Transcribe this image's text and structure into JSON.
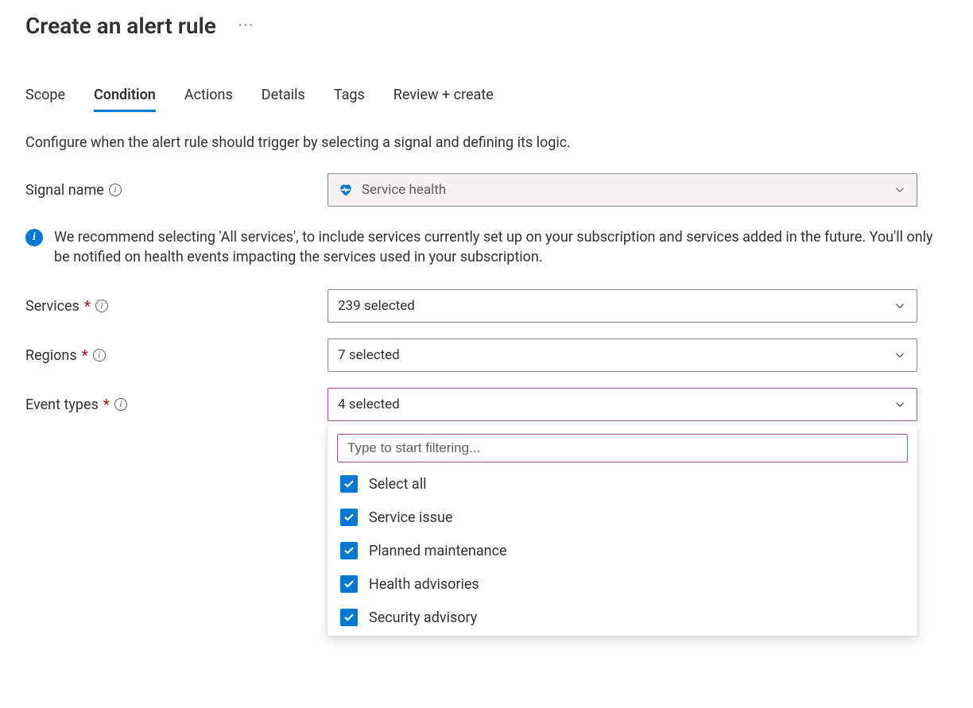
{
  "page": {
    "title": "Create an alert rule"
  },
  "tabs": [
    {
      "label": "Scope",
      "active": false
    },
    {
      "label": "Condition",
      "active": true
    },
    {
      "label": "Actions",
      "active": false
    },
    {
      "label": "Details",
      "active": false
    },
    {
      "label": "Tags",
      "active": false
    },
    {
      "label": "Review + create",
      "active": false
    }
  ],
  "description": "Configure when the alert rule should trigger by selecting a signal and defining its logic.",
  "signal_name": {
    "label": "Signal name",
    "value": "Service health"
  },
  "info_banner": "We recommend selecting 'All services', to include services currently set up on your subscription and services added in the future. You'll only be notified on health events impacting the services used in your subscription.",
  "services": {
    "label": "Services",
    "value": "239 selected"
  },
  "regions": {
    "label": "Regions",
    "value": "7 selected"
  },
  "event_types": {
    "label": "Event types",
    "value": "4 selected",
    "filter_placeholder": "Type to start filtering...",
    "options": [
      {
        "label": "Select all",
        "checked": true
      },
      {
        "label": "Service issue",
        "checked": true
      },
      {
        "label": "Planned maintenance",
        "checked": true
      },
      {
        "label": "Health advisories",
        "checked": true
      },
      {
        "label": "Security advisory",
        "checked": true
      }
    ]
  }
}
